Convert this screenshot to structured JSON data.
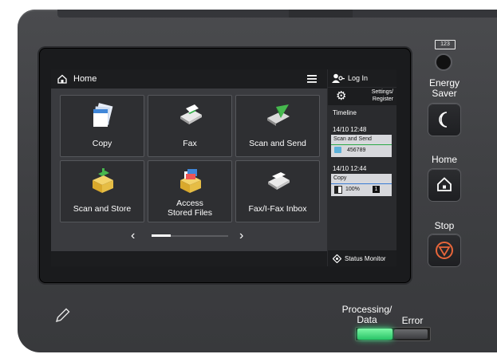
{
  "header": {
    "title": "Home"
  },
  "tiles": [
    {
      "label": "Copy"
    },
    {
      "label": "Fax"
    },
    {
      "label": "Scan and Send"
    },
    {
      "label": "Scan and Store"
    },
    {
      "label_line1": "Access",
      "label_line2": "Stored Files"
    },
    {
      "label": "Fax/I-Fax Inbox"
    }
  ],
  "pager": {
    "prev": "‹",
    "next": "›"
  },
  "side": {
    "login": "Log In",
    "settings_line1": "Settings/",
    "settings_line2": "Register",
    "timeline_title": "Timeline",
    "jobs": [
      {
        "time": "14/10 12:48",
        "name": "Scan and Send",
        "detail": "456789",
        "accent": "#2aa845"
      },
      {
        "time": "14/10 12:44",
        "name": "Copy",
        "detail": "100%",
        "count": "1",
        "accent": "#3a7bd5"
      }
    ],
    "status_monitor": "Status Monitor"
  },
  "hardware": {
    "counter_label": "123",
    "energy_saver_line1": "Energy",
    "energy_saver_line2": "Saver",
    "home": "Home",
    "stop": "Stop",
    "processing_line1": "Processing/",
    "processing_line2": "Data",
    "error": "Error"
  },
  "colors": {
    "stop_accent": "#e8663a",
    "processing_led": "#3af08a"
  }
}
